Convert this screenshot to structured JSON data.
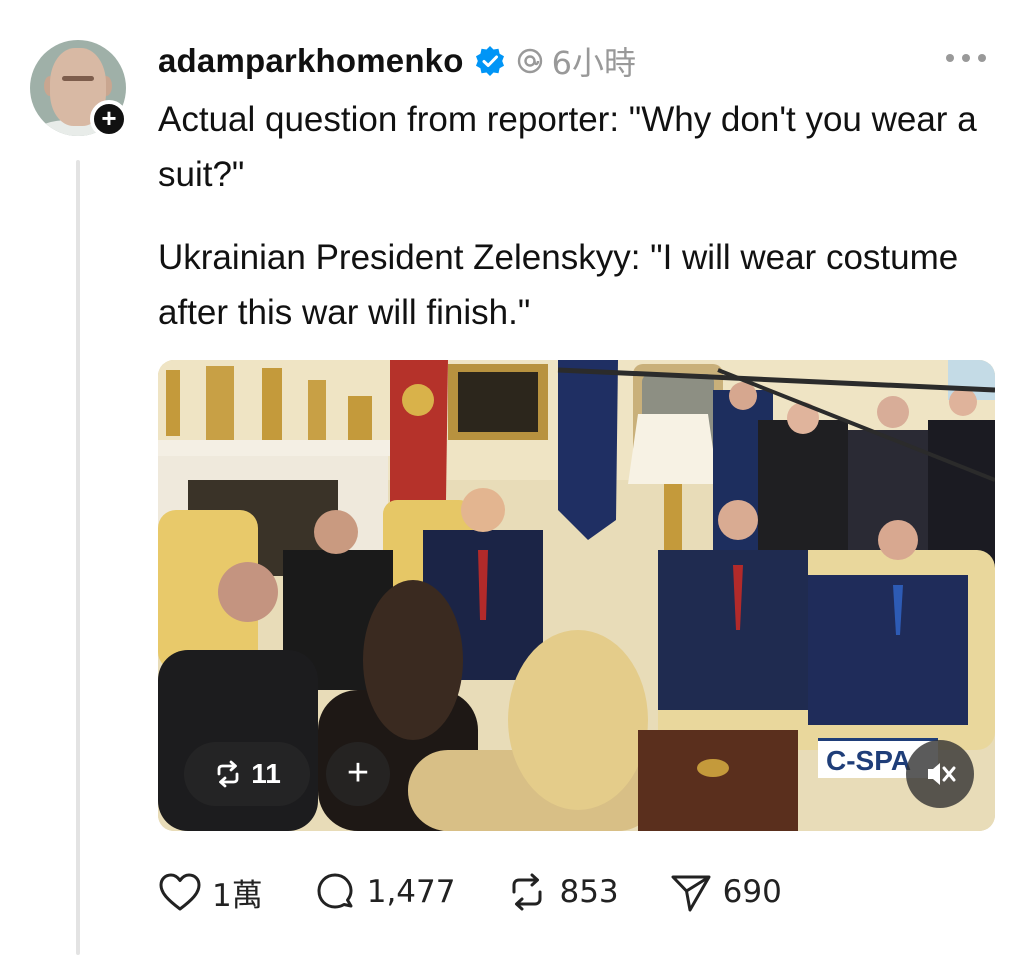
{
  "post": {
    "username": "adamparkhomenko",
    "time": "6小時",
    "paragraphs": [
      "Actual question from reporter: \"Why don't you wear a suit?\"",
      "Ukrainian President Zelenskyy: \"I will wear costume after this war will finish.\""
    ]
  },
  "media": {
    "repost_count": "11",
    "plus_label": "+",
    "watermark": "C-SPA"
  },
  "actions": {
    "likes": "1萬",
    "replies": "1,477",
    "reposts": "853",
    "shares": "690"
  },
  "icons": {
    "verified": "verified-badge-icon",
    "threads": "threads-logo-icon",
    "more": "more-dots-icon",
    "like": "heart-icon",
    "reply": "comment-icon",
    "repost": "repost-icon",
    "share": "send-icon",
    "mute": "speaker-muted-icon"
  },
  "colors": {
    "verified": "#0095f6",
    "text": "#111111",
    "muted": "#999999"
  }
}
